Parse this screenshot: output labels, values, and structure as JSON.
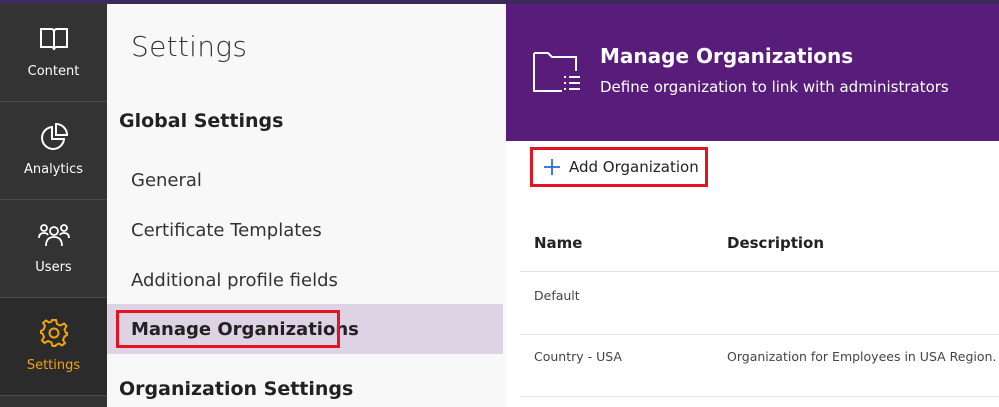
{
  "sidebar": {
    "items": [
      {
        "label": "Content",
        "icon": "book-icon"
      },
      {
        "label": "Analytics",
        "icon": "pie-chart-icon"
      },
      {
        "label": "Users",
        "icon": "users-icon"
      },
      {
        "label": "Settings",
        "icon": "gear-icon",
        "active": true
      }
    ],
    "active_color": "#f0a30a"
  },
  "settings_panel": {
    "title": "Settings",
    "global_heading": "Global Settings",
    "items": [
      {
        "label": "General"
      },
      {
        "label": "Certificate Templates"
      },
      {
        "label": "Additional profile fields"
      },
      {
        "label": "Manage Organizations",
        "selected": true
      }
    ],
    "org_heading": "Organization Settings"
  },
  "main": {
    "banner": {
      "title": "Manage Organizations",
      "subtitle": "Define organization to link with administrators",
      "color": "#581c7a",
      "icon": "folder-list-icon"
    },
    "add_button_label": "Add Organization",
    "table": {
      "columns": [
        "Name",
        "Description"
      ],
      "rows": [
        {
          "name": "Default",
          "description": ""
        },
        {
          "name": "Country - USA",
          "description": "Organization for Employees in USA Region."
        }
      ]
    }
  },
  "highlight_color": "#e3141f"
}
